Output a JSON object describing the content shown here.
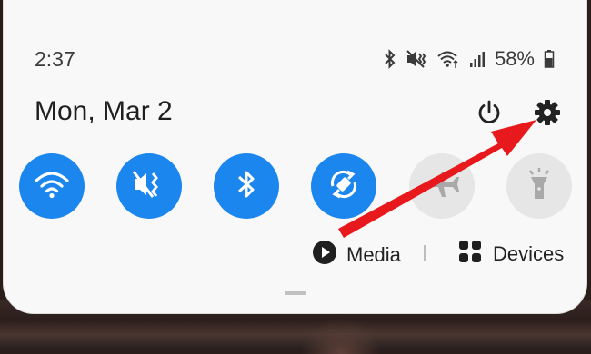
{
  "status_bar": {
    "time": "2:37",
    "battery_percent": "58%",
    "icons": [
      "bluetooth-icon",
      "vibrate-mute-icon",
      "wifi-icon",
      "signal-icon",
      "battery-icon"
    ]
  },
  "header": {
    "date": "Mon, Mar 2",
    "power_icon": "power-icon",
    "settings_icon": "gear-icon"
  },
  "quick_tiles": [
    {
      "name": "wifi",
      "icon": "wifi-icon",
      "state": "on"
    },
    {
      "name": "sound-mute",
      "icon": "mute-vibrate-icon",
      "state": "on"
    },
    {
      "name": "bluetooth",
      "icon": "bluetooth-icon",
      "state": "on"
    },
    {
      "name": "auto-rotate",
      "icon": "rotate-icon",
      "state": "on"
    },
    {
      "name": "airplane-mode",
      "icon": "airplane-icon",
      "state": "off"
    },
    {
      "name": "flashlight",
      "icon": "flashlight-icon",
      "state": "off"
    }
  ],
  "media_row": {
    "media_label": "Media",
    "devices_label": "Devices"
  },
  "colors": {
    "accent_blue": "#1b86ee",
    "inactive_tile": "#e6e6e6",
    "annotation_arrow": "#e8191c"
  }
}
